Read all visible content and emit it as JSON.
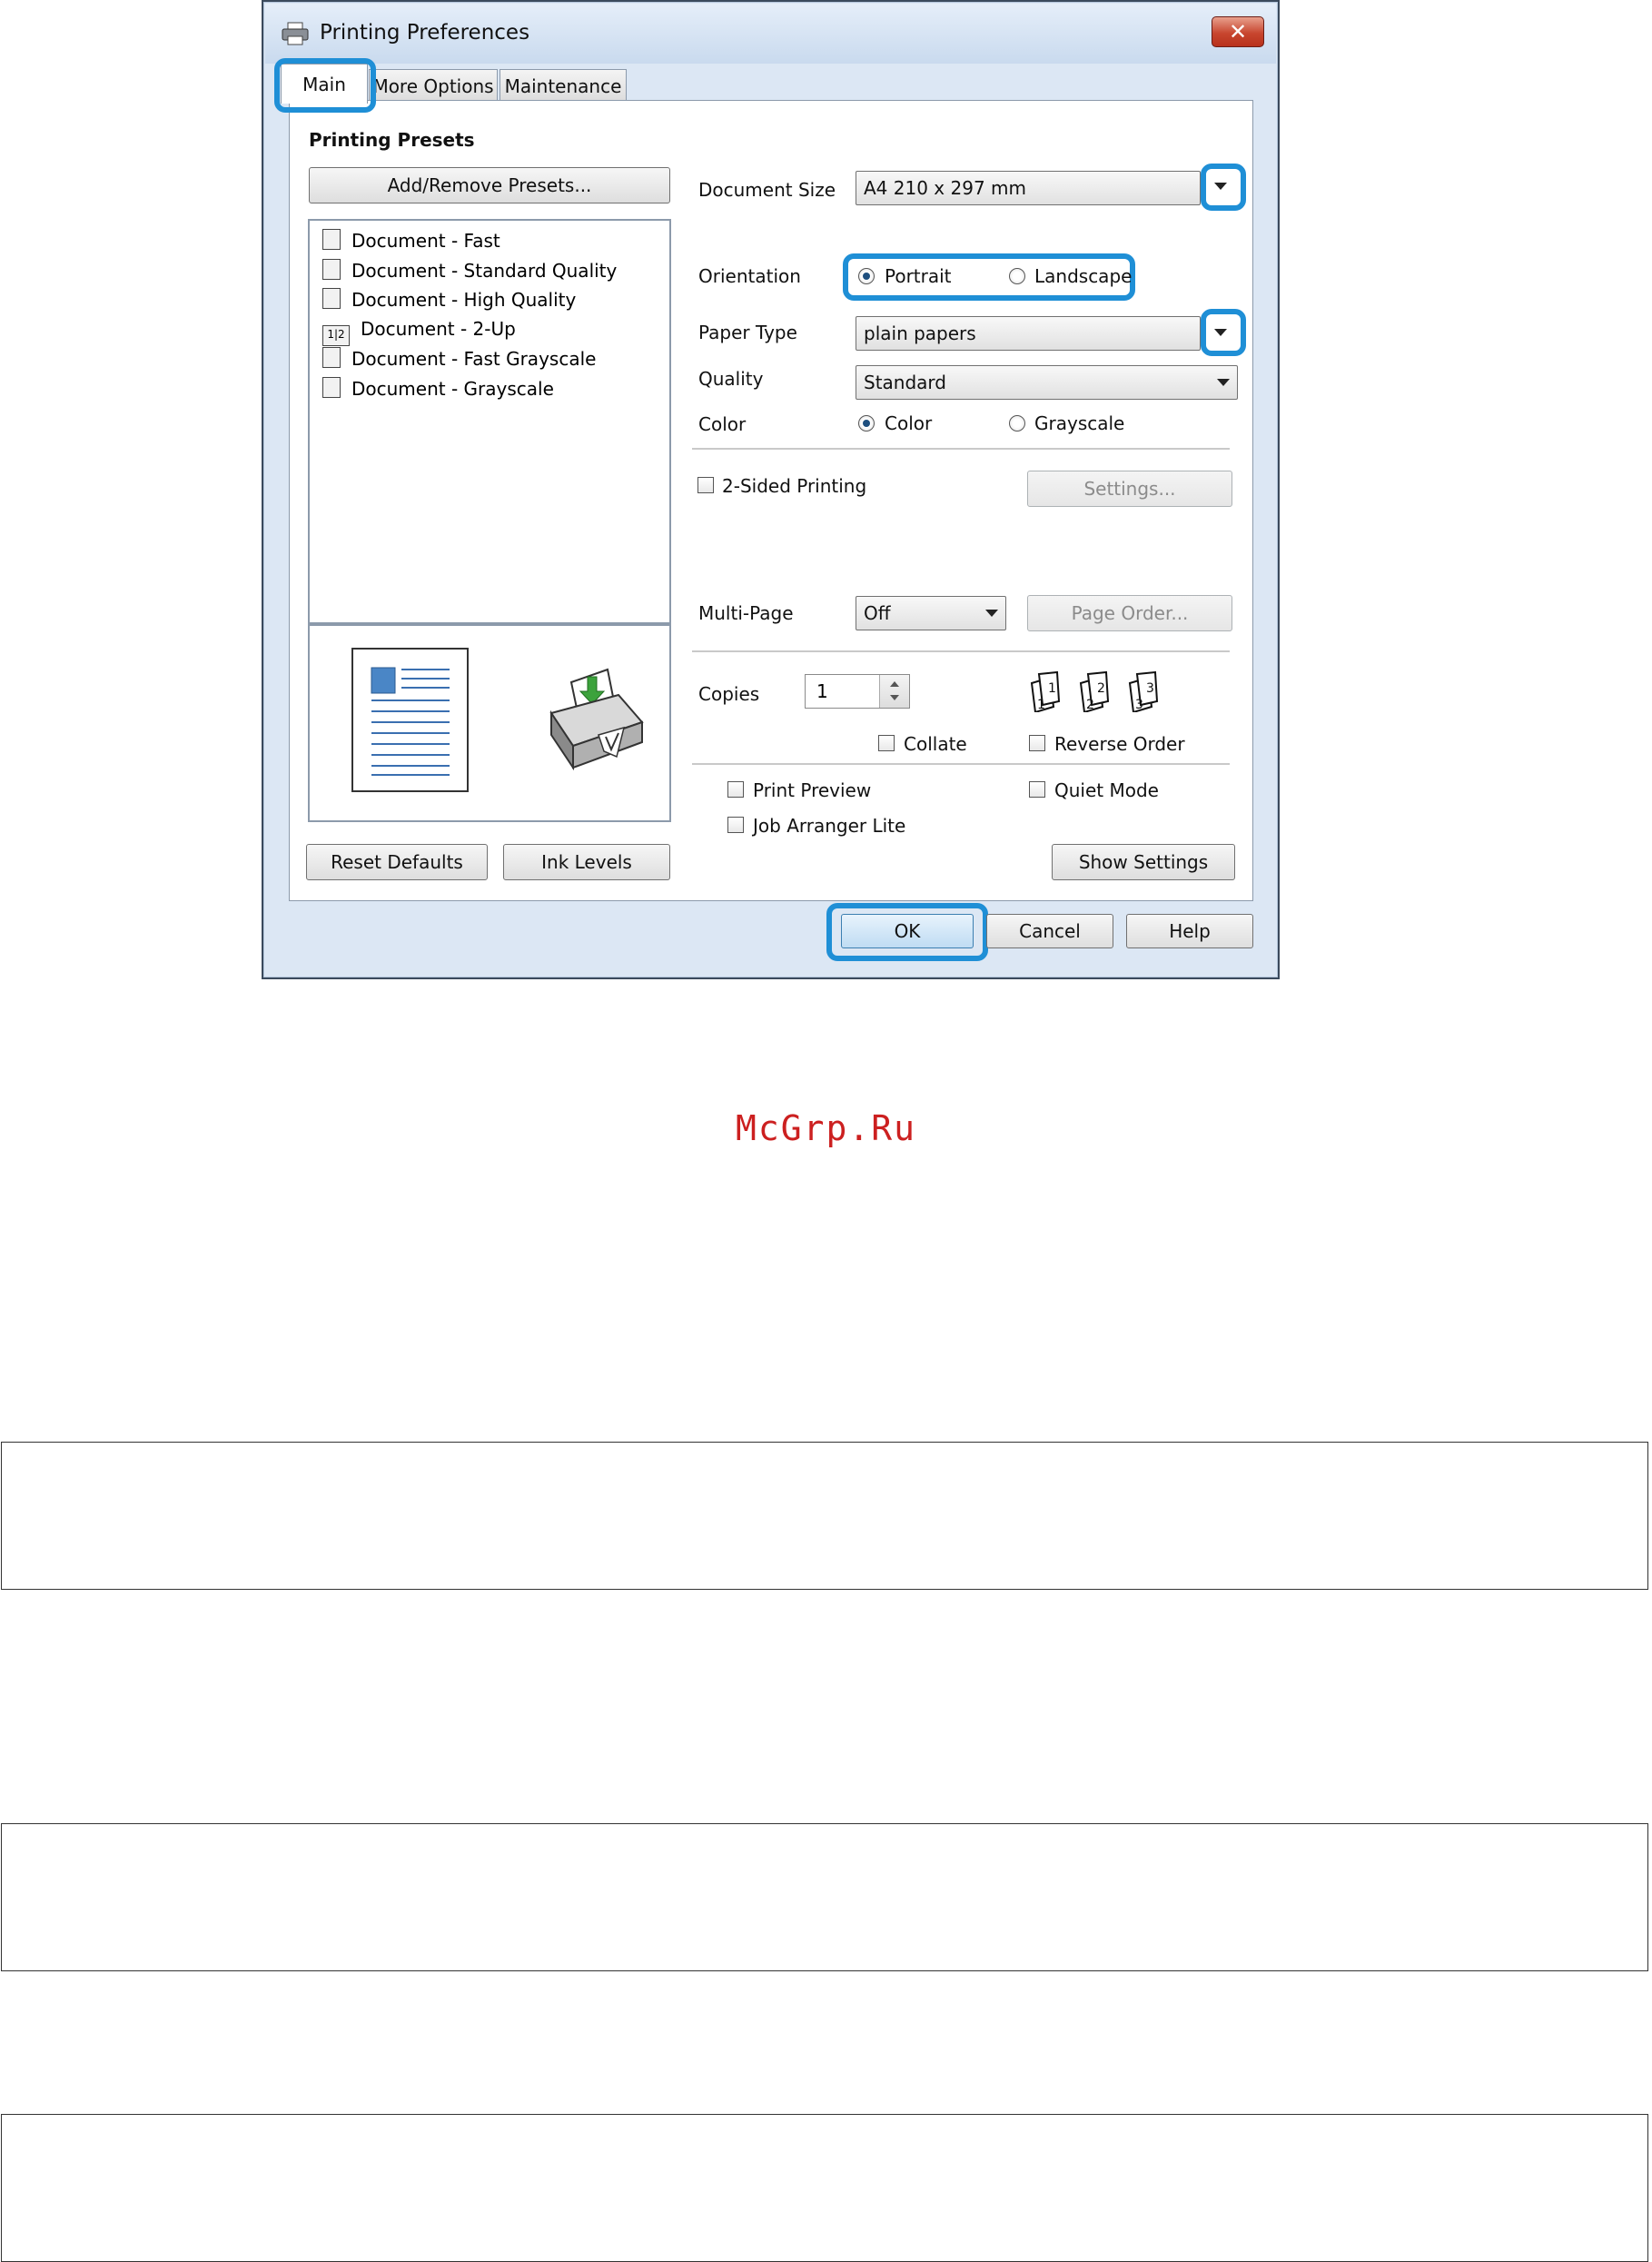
{
  "window": {
    "title": "Printing Preferences",
    "close_symbol": "✕"
  },
  "tabs": [
    {
      "label": "Main"
    },
    {
      "label": "More Options"
    },
    {
      "label": "Maintenance"
    }
  ],
  "presets": {
    "heading": "Printing Presets",
    "add_remove_button": "Add/Remove Presets...",
    "items": [
      {
        "label": "Document - Fast"
      },
      {
        "label": "Document - Standard Quality"
      },
      {
        "label": "Document - High Quality"
      },
      {
        "label": "Document - 2-Up"
      },
      {
        "label": "Document - Fast Grayscale"
      },
      {
        "label": "Document - Grayscale"
      }
    ],
    "two_up_icon_text": "1|2"
  },
  "settings": {
    "document_size_label": "Document Size",
    "document_size_value": "A4 210 x 297 mm",
    "orientation_label": "Orientation",
    "portrait_label": "Portrait",
    "landscape_label": "Landscape",
    "paper_type_label": "Paper Type",
    "paper_type_value": "plain papers",
    "quality_label": "Quality",
    "quality_value": "Standard",
    "color_label": "Color",
    "color_option": "Color",
    "grayscale_option": "Grayscale",
    "two_sided_label": "2-Sided Printing",
    "settings_button": "Settings...",
    "multipage_label": "Multi-Page",
    "multipage_value": "Off",
    "page_order_button": "Page Order...",
    "copies_label": "Copies",
    "copies_value": "1",
    "collate_label": "Collate",
    "reverse_order_label": "Reverse Order",
    "print_preview_label": "Print Preview",
    "quiet_mode_label": "Quiet Mode",
    "job_arranger_label": "Job Arranger Lite",
    "show_settings_button": "Show Settings"
  },
  "footer_buttons": {
    "reset_defaults": "Reset Defaults",
    "ink_levels": "Ink Levels",
    "ok": "OK",
    "cancel": "Cancel",
    "help": "Help"
  },
  "watermark": "McGrp.Ru",
  "colors": {
    "highlight": "#1f8fd6",
    "watermark": "#cc2020"
  }
}
